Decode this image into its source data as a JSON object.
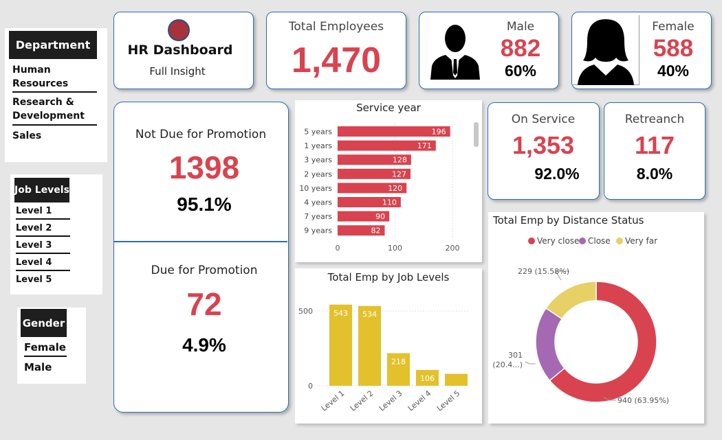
{
  "slicers": {
    "department": {
      "title": "Department",
      "items": [
        "Human Resources",
        "Research & Development",
        "Sales"
      ]
    },
    "job_levels": {
      "title": "Job Levels",
      "items": [
        "Level 1",
        "Level 2",
        "Level 3",
        "Level 4",
        "Level 5"
      ]
    },
    "gender": {
      "title": "Gender",
      "items": [
        "Female",
        "Male"
      ]
    }
  },
  "header": {
    "title": "HR Dashboard",
    "subtitle": "Full Insight"
  },
  "kpis": {
    "total_employees": {
      "label": "Total Employees",
      "value": "1,470"
    },
    "male": {
      "label": "Male",
      "value": "882",
      "pct": "60%"
    },
    "female": {
      "label": "Female",
      "value": "588",
      "pct": "40%"
    },
    "not_due": {
      "label": "Not Due for Promotion",
      "value": "1398",
      "pct": "95.1%"
    },
    "due": {
      "label": "Due for Promotion",
      "value": "72",
      "pct": "4.9%"
    },
    "on_service": {
      "label": "On Service",
      "value": "1,353",
      "pct": "92.0%"
    },
    "retreanch": {
      "label": "Retreanch",
      "value": "117",
      "pct": "8.0%"
    }
  },
  "icons": {
    "male": "male-person-silhouette-icon",
    "female": "female-person-silhouette-icon"
  },
  "colors": {
    "accent_red": "#d9434f",
    "bar_yellow": "#e2c12c",
    "close_purple": "#a569b4",
    "very_far_yellow": "#e7d066",
    "border_blue": "#2a6db5"
  },
  "chart_data": [
    {
      "type": "bar",
      "orientation": "horizontal",
      "title": "Service year",
      "categories": [
        "5 years",
        "1 years",
        "3 years",
        "2 years",
        "10 years",
        "4 years",
        "7 years",
        "9 years"
      ],
      "values": [
        196,
        171,
        128,
        127,
        120,
        110,
        90,
        82
      ],
      "xlim": [
        0,
        200
      ],
      "xticks": [
        "0",
        "100",
        "200"
      ]
    },
    {
      "type": "bar",
      "title": "Total Emp by Job Levels",
      "categories": [
        "Level 1",
        "Level 2",
        "Level 3",
        "Level 4",
        "Level 5"
      ],
      "values": [
        543,
        534,
        218,
        106,
        80
      ],
      "data_labels": [
        "543",
        "534",
        "218",
        "106",
        ""
      ],
      "ylim": [
        0,
        620
      ],
      "yticks": [
        "0",
        "500"
      ]
    },
    {
      "type": "pie",
      "subtype": "donut",
      "title": "Total Emp by Distance Status",
      "legend": [
        "Very close",
        "Close",
        "Very far"
      ],
      "legend_position": "top",
      "values": [
        940,
        301,
        229
      ],
      "labels": [
        "940 (63.95%)",
        "301\n(20.4...)",
        "229 (15.58%)"
      ],
      "colors": [
        "#d9434f",
        "#a569b4",
        "#e7d066"
      ]
    }
  ]
}
